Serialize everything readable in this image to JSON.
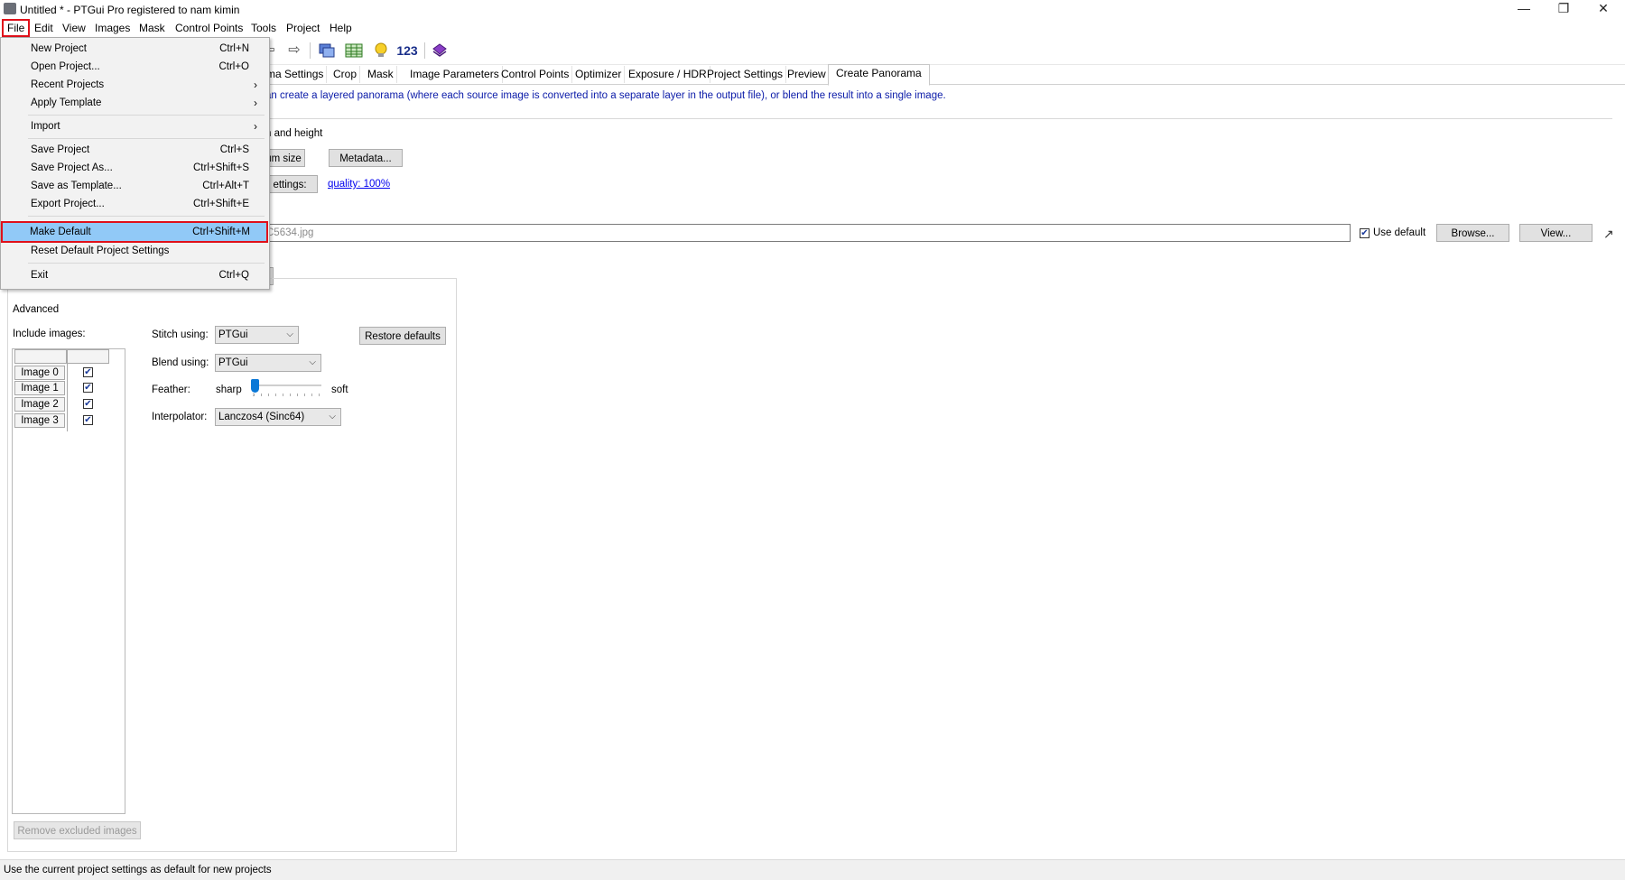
{
  "window": {
    "title": "Untitled * - PTGui Pro registered to nam kimin",
    "controls": [
      "—",
      "❐",
      "✕"
    ]
  },
  "menubar": [
    "File",
    "Edit",
    "View",
    "Images",
    "Mask",
    "Control Points",
    "Tools",
    "Project",
    "Help"
  ],
  "toolbar": {
    "icons": [
      "open-arrow-icon",
      "forward-arrow-icon",
      "panorama-editor-icon",
      "table-icon",
      "lightbulb-icon",
      "numbering-icon",
      "book-icon"
    ],
    "numbering_label": "123"
  },
  "tabs": [
    "ma Settings",
    "Crop",
    "Mask",
    "Image Parameters",
    "Control Points",
    "Optimizer",
    "Exposure / HDR",
    "Project Settings",
    "Preview",
    "Create Panorama"
  ],
  "active_tab": "Create Panorama",
  "content": {
    "info_text": "an create a layered panorama (where each source image is converted into a separate layer in the output file), or blend the result into a single image.",
    "width_height_label": "h and height",
    "optimum_size_button": "um size",
    "metadata_button": "Metadata...",
    "settings_button": "ettings:",
    "quality_link": "quality: 100%",
    "output_file_value": "C5634.jpg",
    "use_default_label": "Use default",
    "use_default_checked": true,
    "browse_button": "Browse...",
    "view_button": "View..."
  },
  "advanced": {
    "legend": "Advanced",
    "include_images_label": "Include images:",
    "images": [
      {
        "label": "Image 0",
        "checked": true
      },
      {
        "label": "Image 1",
        "checked": true
      },
      {
        "label": "Image 2",
        "checked": true
      },
      {
        "label": "Image 3",
        "checked": true
      }
    ],
    "remove_excluded_button": "Remove excluded images",
    "stitch_using_label": "Stitch using:",
    "stitch_using_value": "PTGui",
    "blend_using_label": "Blend using:",
    "blend_using_value": "PTGui",
    "feather_label": "Feather:",
    "feather_sharp": "sharp",
    "feather_soft": "soft",
    "feather_level": 0.0,
    "interpolator_label": "Interpolator:",
    "interpolator_value": "Lanczos4 (Sinc64)",
    "restore_defaults_button": "Restore defaults"
  },
  "file_menu": {
    "items": [
      {
        "label": "New Project",
        "shortcut": "Ctrl+N"
      },
      {
        "label": "Open Project...",
        "shortcut": "Ctrl+O"
      },
      {
        "label": "Recent Projects",
        "submenu": true
      },
      {
        "label": "Apply Template",
        "submenu": true
      },
      {
        "separator": true
      },
      {
        "label": "Import",
        "submenu": true
      },
      {
        "separator": true
      },
      {
        "label": "Save Project",
        "shortcut": "Ctrl+S"
      },
      {
        "label": "Save Project As...",
        "shortcut": "Ctrl+Shift+S"
      },
      {
        "label": "Save as Template...",
        "shortcut": "Ctrl+Alt+T"
      },
      {
        "label": "Export Project...",
        "shortcut": "Ctrl+Shift+E"
      },
      {
        "separator": true
      },
      {
        "label": "Make Default",
        "shortcut": "Ctrl+Shift+M",
        "highlighted": true
      },
      {
        "label": "Reset Default Project Settings"
      },
      {
        "separator": true
      },
      {
        "label": "Exit",
        "shortcut": "Ctrl+Q"
      }
    ]
  },
  "statusbar": {
    "text": "Use the current project settings as default for new projects"
  },
  "colors": {
    "menu_highlight": "#91c9f7",
    "annotation_red": "#e0101a",
    "info_text_blue": "#0a1aa8",
    "link_blue": "#0000ee"
  }
}
